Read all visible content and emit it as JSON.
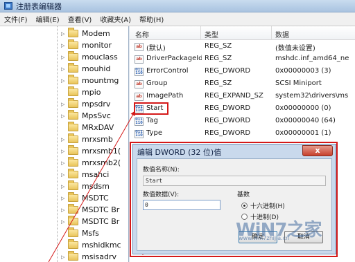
{
  "window": {
    "title": "注册表编辑器"
  },
  "menu": [
    "文件(F)",
    "编辑(E)",
    "查看(V)",
    "收藏夹(A)",
    "帮助(H)"
  ],
  "tree": {
    "items": [
      {
        "label": "Modem",
        "expandable": true
      },
      {
        "label": "monitor",
        "expandable": true
      },
      {
        "label": "mouclass",
        "expandable": true
      },
      {
        "label": "mouhid",
        "expandable": true
      },
      {
        "label": "mountmg",
        "expandable": true
      },
      {
        "label": "mpio",
        "expandable": false
      },
      {
        "label": "mpsdrv",
        "expandable": true
      },
      {
        "label": "MpsSvc",
        "expandable": true
      },
      {
        "label": "MRxDAV",
        "expandable": false
      },
      {
        "label": "mrxsmb",
        "expandable": true
      },
      {
        "label": "mrxsmb1(",
        "expandable": true
      },
      {
        "label": "mrxsmb2(",
        "expandable": true
      },
      {
        "label": "msahci",
        "expandable": true
      },
      {
        "label": "msdsm",
        "expandable": true
      },
      {
        "label": "MSDTC",
        "expandable": true
      },
      {
        "label": "MSDTC Br",
        "expandable": true
      },
      {
        "label": "MSDTC Br",
        "expandable": true
      },
      {
        "label": "Msfs",
        "expandable": false
      },
      {
        "label": "mshidkmc",
        "expandable": false
      },
      {
        "label": "msisadrv",
        "expandable": true
      }
    ]
  },
  "list": {
    "headers": {
      "name": "名称",
      "type": "类型",
      "data": "数据"
    },
    "rows": [
      {
        "icon": "string-value-icon",
        "name": "(默认)",
        "type": "REG_SZ",
        "data": "(数值未设置)"
      },
      {
        "icon": "string-value-icon",
        "name": "DriverPackageId",
        "type": "REG_SZ",
        "data": "mshdc.inf_amd64_ne"
      },
      {
        "icon": "dword-value-icon",
        "name": "ErrorControl",
        "type": "REG_DWORD",
        "data": "0x00000003 (3)"
      },
      {
        "icon": "string-value-icon",
        "name": "Group",
        "type": "REG_SZ",
        "data": "SCSI Miniport"
      },
      {
        "icon": "string-value-icon",
        "name": "ImagePath",
        "type": "REG_EXPAND_SZ",
        "data": "system32\\drivers\\ms"
      },
      {
        "icon": "dword-value-icon",
        "name": "Start",
        "type": "REG_DWORD",
        "data": "0x00000000 (0)"
      },
      {
        "icon": "dword-value-icon",
        "name": "Tag",
        "type": "REG_DWORD",
        "data": "0x00000040 (64)"
      },
      {
        "icon": "dword-value-icon",
        "name": "Type",
        "type": "REG_DWORD",
        "data": "0x00000001 (1)"
      }
    ]
  },
  "dialog": {
    "title": "编辑 DWORD (32 位)值",
    "close_label": "x",
    "value_name_label": "数值名称(N):",
    "value_name": "Start",
    "value_data_label": "数值数据(V):",
    "value_data": "0",
    "base_label": "基数",
    "base_options": [
      {
        "label": "十六进制(H)",
        "selected": true
      },
      {
        "label": "十进制(D)",
        "selected": false
      }
    ],
    "ok_label": "确定",
    "cancel_label": "取消"
  },
  "watermark": {
    "text": "WiN7之家",
    "sub": "www.win7zhijia.cn"
  },
  "colors": {
    "highlight_red": "#d41919",
    "title_blue": "#a9c3e0"
  }
}
